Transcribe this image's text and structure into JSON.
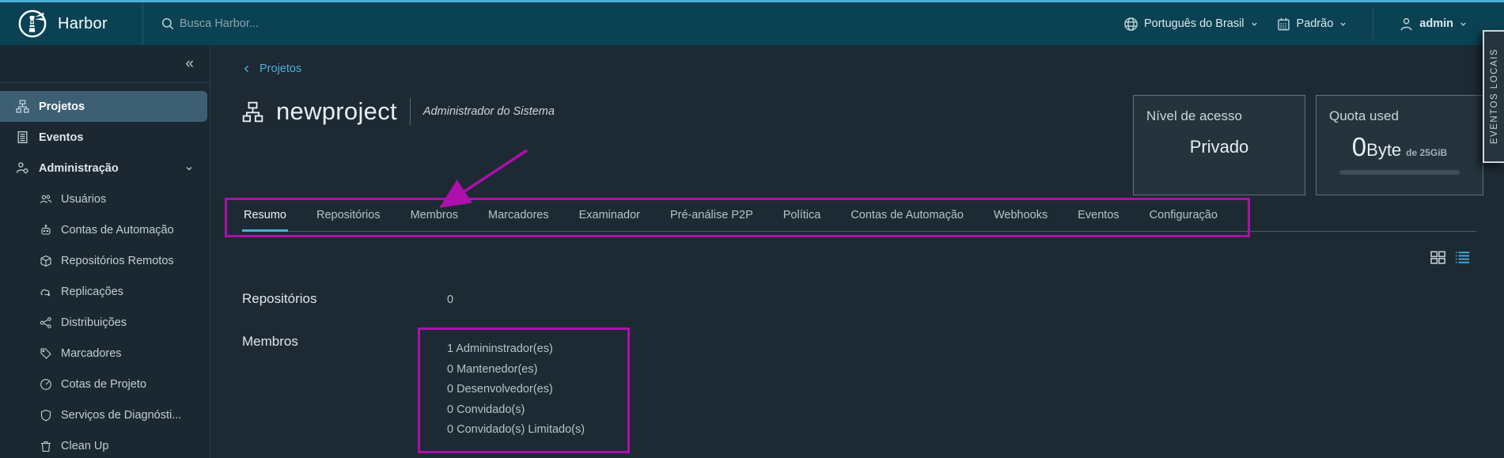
{
  "annotation_color": "#ad10ad",
  "header": {
    "brand": "Harbor",
    "search_placeholder": "Busca Harbor...",
    "language": "Português do Brasil",
    "theme": "Padrão",
    "user": "admin"
  },
  "sidebar": {
    "collapse_glyph": "«",
    "items": [
      {
        "label": "Projetos"
      },
      {
        "label": "Eventos"
      },
      {
        "label": "Administração"
      }
    ],
    "admin_children": [
      {
        "label": "Usuários"
      },
      {
        "label": "Contas de Automação"
      },
      {
        "label": "Repositórios Remotos"
      },
      {
        "label": "Replicações"
      },
      {
        "label": "Distribuições"
      },
      {
        "label": "Marcadores"
      },
      {
        "label": "Cotas de Projeto"
      },
      {
        "label": "Serviços de Diagnósti..."
      },
      {
        "label": "Clean Up"
      }
    ]
  },
  "main": {
    "breadcrumb": "Projetos",
    "title": "newproject",
    "subtitle": "Administrador do Sistema",
    "tabs": [
      "Resumo",
      "Repositórios",
      "Membros",
      "Marcadores",
      "Examinador",
      "Pré-análise P2P",
      "Política",
      "Contas de Automação",
      "Webhooks",
      "Eventos",
      "Configuração"
    ],
    "active_tab": "Resumo",
    "cards": {
      "access": {
        "title": "Nível de acesso",
        "value": "Privado"
      },
      "quota": {
        "title": "Quota used",
        "used": "0",
        "unit": "Byte",
        "suffix": "de 25GiB"
      }
    },
    "summary": {
      "repos_label": "Repositórios",
      "repos_value": "0",
      "members_label": "Membros",
      "members": [
        "1 Admininstrador(es)",
        "0 Mantenedor(es)",
        "0 Desenvolvedor(es)",
        "0 Convidado(s)",
        "0 Convidado(s) Limitado(s)"
      ]
    }
  },
  "right_tab": {
    "label": "EVENTOS LOCAIS"
  }
}
